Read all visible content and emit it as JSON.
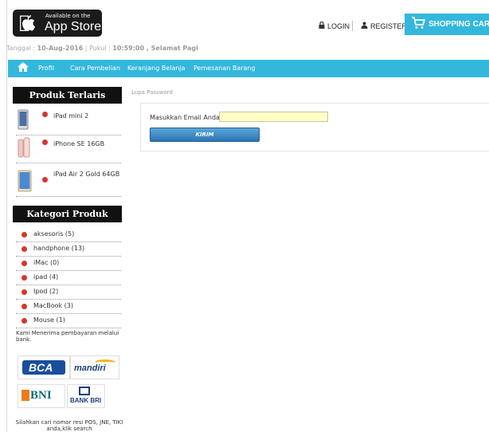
{
  "header": {
    "appstore_small": "Available on the",
    "appstore_big": "App Store",
    "login": "LOGIN",
    "register": "REGISTER",
    "cart": "SHOPPING CART",
    "date_label": "Tanggal : ",
    "date_value": "10-Aug-2016",
    "time_label": " | Pukul : ",
    "time_value": "10:59:00",
    "greeting": " , Selamat Pagi"
  },
  "nav": {
    "items": [
      "Profil",
      "Cara Pembelian",
      "Keranjang Belanja",
      "Pemesanan Barang"
    ]
  },
  "sidebar": {
    "top_products_title": "Produk Terlaris",
    "top_products": [
      "iPad mini 2",
      "iPhone SE 16GB",
      "iPad Air 2 Gold 64GB"
    ],
    "categories_title": "Kategori Produk",
    "categories": [
      "aksesoris (5)",
      "handphone (13)",
      "iMac (0)",
      "ipad (4)",
      "Ipod (2)",
      "MacBook (3)",
      "Mouse (1)"
    ],
    "bank_note": "Kami Menerima pembayaran melalui bank.",
    "banks": [
      "BCA",
      "mandiri",
      "BNI",
      "BANK BRI"
    ],
    "search_note": "Silahkan cari nomor resi POS, JNE, TIKI anda,klik search"
  },
  "main": {
    "breadcrumb": "Lupa Password",
    "email_label": "Masukkan Email Anda",
    "email_value": "",
    "submit": "KIRIM"
  },
  "colors": {
    "accent": "#33b7dc",
    "bullet": "#d6362a",
    "input_bg": "#ffffc6",
    "button": "#2c75b5"
  }
}
